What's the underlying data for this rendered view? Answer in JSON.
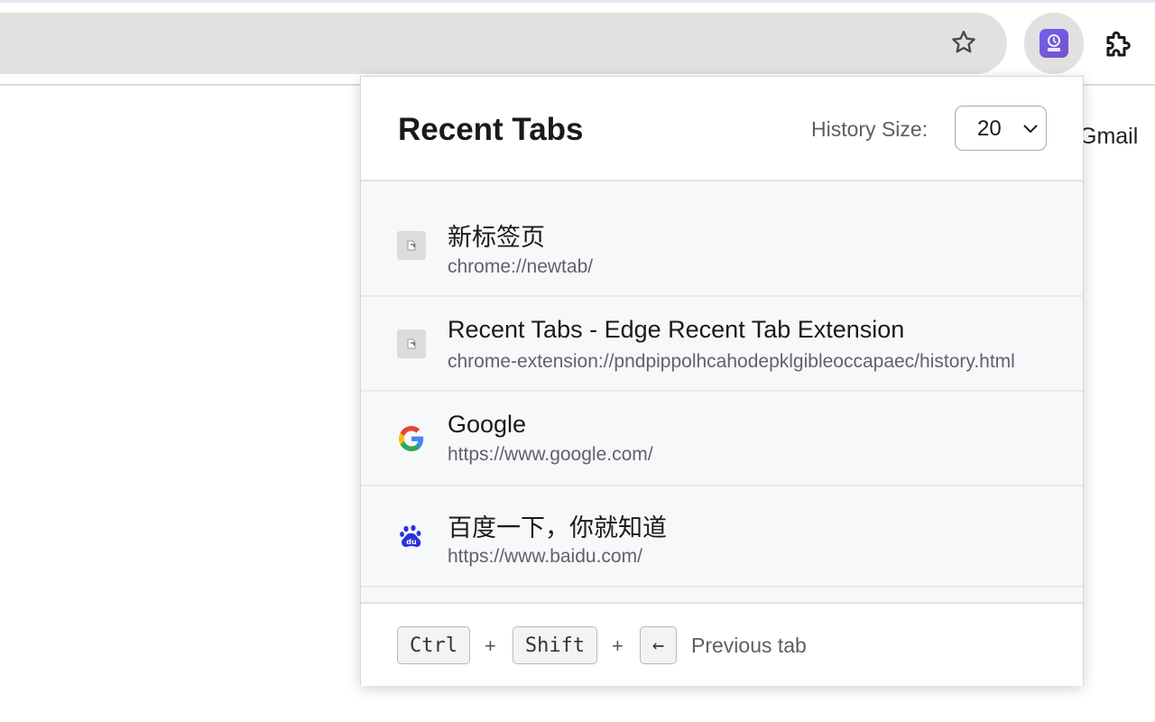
{
  "browser": {
    "gmail_link": "Gmail",
    "icons": {
      "bookmark": "star-outline-icon",
      "extension_app": "recent-tabs-extension-icon",
      "extensions": "puzzle-icon"
    }
  },
  "popup": {
    "title": "Recent Tabs",
    "history_size_label": "History Size:",
    "history_size_value": "20",
    "tabs": [
      {
        "title": "新标签页",
        "url": "chrome://newtab/",
        "favicon": "generic-page-icon"
      },
      {
        "title": "Recent Tabs - Edge Recent Tab Extension",
        "url": "chrome-extension://pndpippolhcahodepklgibleoccapaec/history.html",
        "favicon": "generic-page-icon"
      },
      {
        "title": "Google",
        "url": "https://www.google.com/",
        "favicon": "google-icon"
      },
      {
        "title": "百度一下，你就知道",
        "url": "https://www.baidu.com/",
        "favicon": "baidu-icon"
      }
    ],
    "shortcut": {
      "keys": [
        "Ctrl",
        "Shift",
        "←"
      ],
      "separator": "+",
      "description": "Previous tab"
    }
  },
  "colors": {
    "omnibox_bg": "#e1e1e1",
    "list_bg": "#f7f8fa",
    "extension_gradient_start": "#6c63f0",
    "extension_gradient_end": "#7a4fc8",
    "baidu_blue": "#2932e1"
  }
}
